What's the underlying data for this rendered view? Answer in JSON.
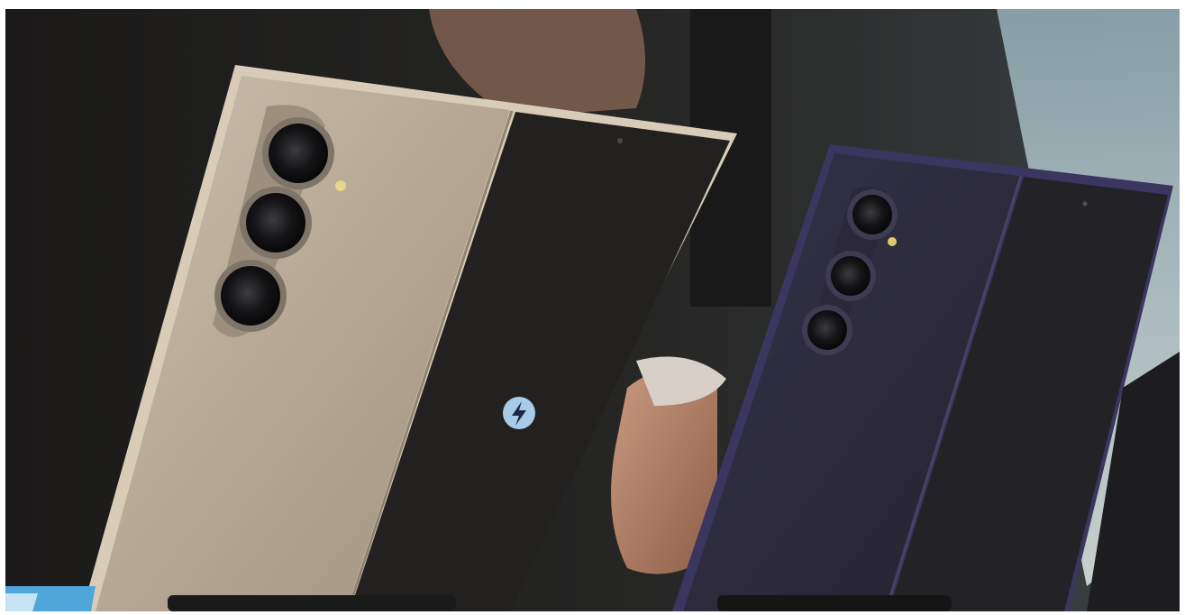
{
  "photo": {
    "subject": "two-foldable-phones-on-display",
    "phones": [
      {
        "id": "left-phone",
        "back_color": "#b9ab98",
        "cover_screen_color": "#232120",
        "frame_color": "#d8ccb9",
        "camera_lens_count": 3,
        "cover_screen_icon": "lightning-bolt-icon"
      },
      {
        "id": "right-phone",
        "back_color": "#2d2b3f",
        "cover_screen_color": "#232226",
        "frame_color": "#3b3660",
        "camera_lens_count": 3
      }
    ],
    "colors": {
      "background_dark": "#1e1d1c",
      "window_light": "#a9bfc6",
      "badge_blue": "#a8cbe8",
      "corner_blue": "#4fa6da"
    }
  }
}
